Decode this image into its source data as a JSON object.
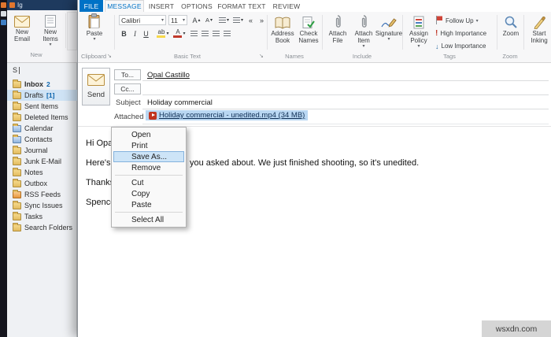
{
  "leftbar": {
    "title": "Ig"
  },
  "behind_ribbon": {
    "new_email": "New Email",
    "new_items": "New Items",
    "group_label": "New"
  },
  "nav": {
    "header": "S",
    "folders": [
      {
        "label": "Inbox",
        "badge": "2"
      },
      {
        "label": "Drafts",
        "badge": "[1]"
      },
      {
        "label": "Sent Items"
      },
      {
        "label": "Deleted Items"
      },
      {
        "label": "Calendar"
      },
      {
        "label": "Contacts"
      },
      {
        "label": "Journal"
      },
      {
        "label": "Junk E-Mail"
      },
      {
        "label": "Notes"
      },
      {
        "label": "Outbox"
      },
      {
        "label": "RSS Feeds"
      },
      {
        "label": "Sync Issues"
      },
      {
        "label": "Tasks"
      },
      {
        "label": "Search Folders"
      }
    ]
  },
  "tabs": {
    "file": "FILE",
    "message": "MESSAGE",
    "insert": "INSERT",
    "options": "OPTIONS",
    "format_text": "FORMAT TEXT",
    "review": "REVIEW"
  },
  "ribbon": {
    "paste": "Paste",
    "clipboard_label": "Clipboard",
    "font_name": "Calibri",
    "font_size": "11",
    "bold": "B",
    "italic": "I",
    "underline": "U",
    "highlight": "ab",
    "font_color": "A",
    "basic_text_label": "Basic Text",
    "address_book": "Address Book",
    "check_names": "Check Names",
    "names_label": "Names",
    "attach_file": "Attach File",
    "attach_item": "Attach Item",
    "signature": "Signature",
    "include_label": "Include",
    "assign_policy": "Assign Policy",
    "follow_up": "Follow Up",
    "high_importance": "High Importance",
    "low_importance": "Low Importance",
    "tags_label": "Tags",
    "zoom": "Zoom",
    "zoom_label": "Zoom",
    "start_inking": "Start Inking"
  },
  "icons": {
    "dropdown": "▾",
    "dialog_launcher": "↘",
    "grow_font": "A",
    "shrink_font": "A",
    "up": "▴",
    "down": "▾",
    "indent_left": "«",
    "indent_right": "»",
    "high_importance": "!",
    "low_importance": "↓"
  },
  "compose": {
    "send": "Send",
    "to_button": "To...",
    "to_value": "Opal Castillo",
    "cc_button": "Cc...",
    "subject_label": "Subject",
    "subject_value": "Holiday commercial",
    "attached_label": "Attached",
    "attachment": "Holiday commercial - unedited.mp4 (34 MB)",
    "body_line1": "Hi Opal,",
    "body_line2_left": "Here's",
    "body_line2_right": "you asked about. We just finished shooting, so it's unedited.",
    "body_line3": "Thanks,",
    "body_line4": "Spence"
  },
  "context_menu": {
    "items": [
      "Open",
      "Print",
      "Save As...",
      "Remove",
      "Cut",
      "Copy",
      "Paste",
      "Select All"
    ]
  },
  "watermark": "wsxdn.com"
}
